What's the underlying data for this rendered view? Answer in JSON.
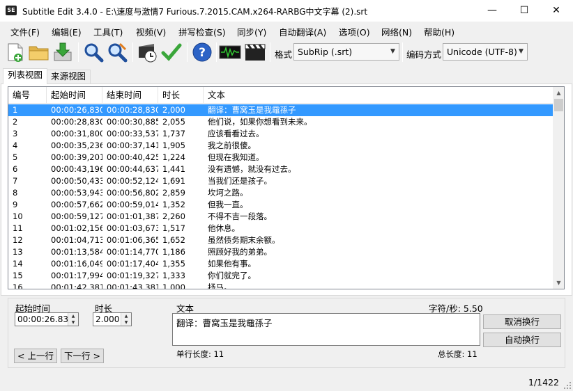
{
  "window": {
    "title": "Subtitle Edit 3.4.0 - E:\\速度与激情7 Furious.7.2015.CAM.x264-RARBG中文字幕 (2).srt",
    "icon_text": "SE",
    "minimize": "—",
    "maximize": "☐",
    "close": "✕"
  },
  "menu": [
    "文件(F)",
    "编辑(E)",
    "工具(T)",
    "视频(V)",
    "拼写检查(S)",
    "同步(Y)",
    "自动翻译(A)",
    "选项(O)",
    "网络(N)",
    "帮助(H)"
  ],
  "toolbar": {
    "format_label": "格式",
    "format_value": "SubRip (.srt)",
    "encoding_label": "编码方式",
    "encoding_value": "Unicode (UTF-8)",
    "dropdown_arrow": "▼"
  },
  "tabs": [
    "列表视图",
    "来源视图"
  ],
  "list": {
    "columns": [
      "编号",
      "起始时间",
      "结束时间",
      "时长",
      "文本"
    ],
    "rows": [
      [
        "1",
        "00:00:26,830",
        "00:00:28,830",
        "2,000",
        "翻译：曹窝玉是我黿孫子"
      ],
      [
        "2",
        "00:00:28,830",
        "00:00:30,885",
        "2,055",
        "他们说，如果你想看到未来。"
      ],
      [
        "3",
        "00:00:31,800",
        "00:00:33,537",
        "1,737",
        "应该看看过去。"
      ],
      [
        "4",
        "00:00:35,236",
        "00:00:37,141",
        "1,905",
        "我之前很傻。"
      ],
      [
        "5",
        "00:00:39,201",
        "00:00:40,425",
        "1,224",
        "但现在我知道。"
      ],
      [
        "6",
        "00:00:43,196",
        "00:00:44,637",
        "1,441",
        "没有遗憾，就没有过去。"
      ],
      [
        "7",
        "00:00:50,433",
        "00:00:52,124",
        "1,691",
        "当我们还是孩子。"
      ],
      [
        "8",
        "00:00:53,943",
        "00:00:56,802",
        "2,859",
        "坎坷之路。"
      ],
      [
        "9",
        "00:00:57,662",
        "00:00:59,014",
        "1,352",
        "但我一直。"
      ],
      [
        "10",
        "00:00:59,127",
        "00:01:01,387",
        "2,260",
        "不得不吉一段落。"
      ],
      [
        "11",
        "00:01:02,156",
        "00:01:03,673",
        "1,517",
        "他休息。"
      ],
      [
        "12",
        "00:01:04,713",
        "00:01:06,365",
        "1,652",
        "虽然债务期末余额。"
      ],
      [
        "13",
        "00:01:13,584",
        "00:01:14,770",
        "1,186",
        "照顾好我的弟弟。"
      ],
      [
        "14",
        "00:01:16,049",
        "00:01:17,404",
        "1,355",
        "如果他有事。"
      ],
      [
        "15",
        "00:01:17,994",
        "00:01:19,327",
        "1,333",
        "你们就完了。"
      ],
      [
        "16",
        "00:01:42,381",
        "00:01:43,381",
        "1,000",
        "抒马。"
      ]
    ],
    "selected_index": 0,
    "scroll_up": "▲",
    "scroll_down": "▼"
  },
  "edit": {
    "start_label": "起始时间",
    "start_value": "00:00:26.830",
    "duration_label": "时长",
    "duration_value": "2.000",
    "text_label": "文本",
    "cps_label": "字符/秒: 5.50",
    "text_value": "翻译：曹窝玉是我黿孫子",
    "single_line_label": "单行长度: 11",
    "total_length_label": "总长度: 11",
    "unbreak_button": "取消换行",
    "autobreak_button": "自动换行",
    "prev_button": "< 上一行",
    "next_button": "下一行 >",
    "spin_up": "▲",
    "spin_down": "▼"
  },
  "status": {
    "count": "1/1422"
  },
  "colors": {
    "selection": "#3399ff",
    "window_bg": "#f0f0f0"
  }
}
